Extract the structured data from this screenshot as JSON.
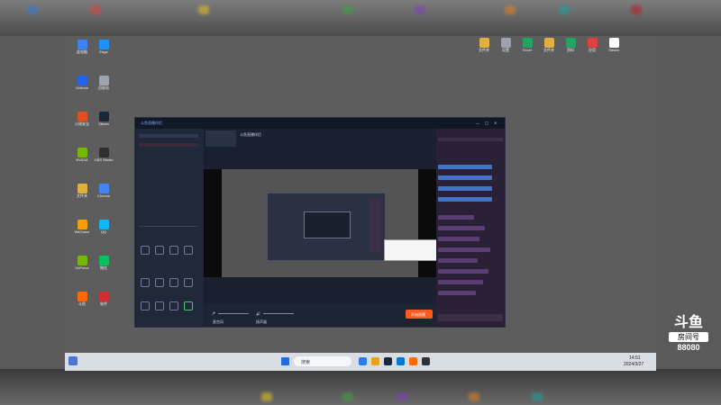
{
  "top_blur": {
    "colors": [
      "#3a7bd5",
      "#e04040",
      "#e8c020",
      "#40a040",
      "#8040c0",
      "#e08020",
      "#20a0a0",
      "#c02020"
    ]
  },
  "desktop": {
    "icons": [
      {
        "label": "此电脑",
        "color": "#3b82f6"
      },
      {
        "label": "Outlook",
        "color": "#2563eb"
      },
      {
        "label": "火绒安全",
        "color": "#e05020"
      },
      {
        "label": "NVIDIA",
        "color": "#76b900"
      },
      {
        "label": "文件夹",
        "color": "#e0b040"
      },
      {
        "label": "WeGame",
        "color": "#f59e0b"
      },
      {
        "label": "GeForce",
        "color": "#76b900"
      },
      {
        "label": "斗鱼",
        "color": "#ff6a00"
      },
      {
        "label": "Edge",
        "color": "#1e90ff"
      },
      {
        "label": "回收站",
        "color": "#9ca3af"
      },
      {
        "label": "Steam",
        "color": "#1b2838"
      },
      {
        "label": "OBS Studio",
        "color": "#302e31"
      },
      {
        "label": "Chrome",
        "color": "#4285f4"
      },
      {
        "label": "QQ",
        "color": "#12b7f5"
      },
      {
        "label": "微信",
        "color": "#07c160"
      },
      {
        "label": "软件",
        "color": "#d02f2f"
      }
    ],
    "right_icons": [
      {
        "label": "文件夹",
        "color": "#e0b040"
      },
      {
        "label": "设置",
        "color": "#9ca3af"
      },
      {
        "label": "Excel",
        "color": "#21a366"
      },
      {
        "label": "文件夹",
        "color": "#e0b040"
      },
      {
        "label": "资料",
        "color": "#21a366"
      },
      {
        "label": "应用",
        "color": "#e04040"
      },
      {
        "label": "Steam",
        "color": "#ffffff"
      }
    ]
  },
  "app": {
    "title": "斗鱼直播伴侣",
    "preview_title": "斗鱼直播伴侣",
    "start_button": "开始直播",
    "bottom_labels": [
      "麦克风",
      "扬声器"
    ]
  },
  "taskbar": {
    "search": "搜索",
    "time": "14:51",
    "date": "2024/3/27"
  },
  "watermark": {
    "brand": "斗鱼",
    "sub": "房间号",
    "room": "88080"
  }
}
